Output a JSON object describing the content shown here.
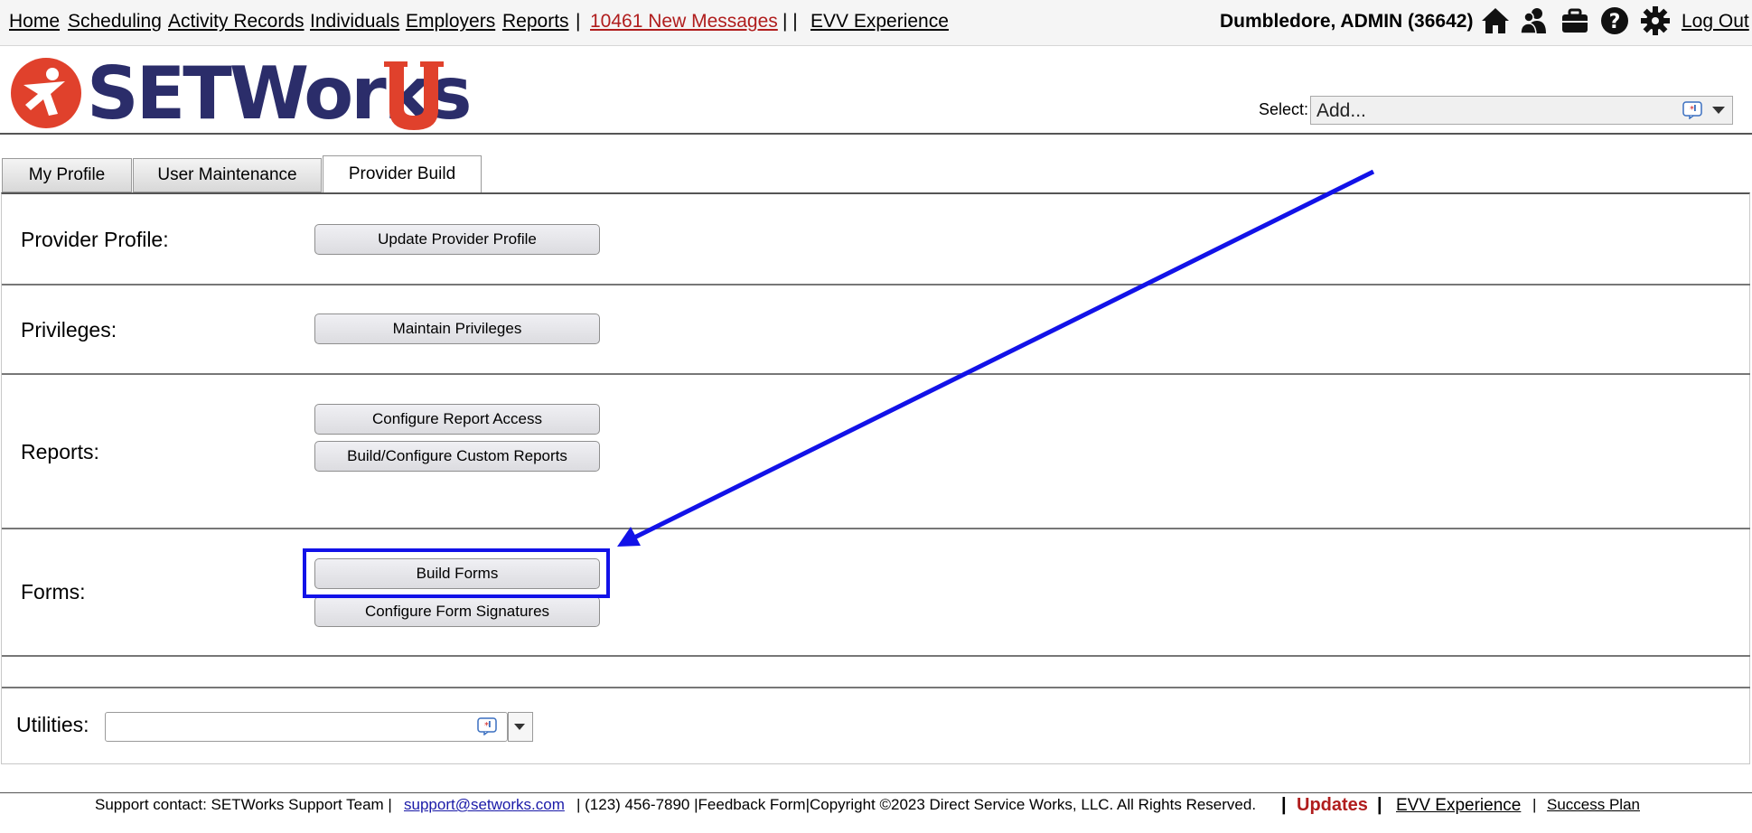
{
  "nav": {
    "links": [
      "Home",
      "Scheduling",
      "Activity Records",
      "Individuals",
      "Employers",
      "Reports"
    ],
    "separator": "|",
    "double_separator": "| |",
    "messages": "10461 New Messages",
    "evv": "EVV Experience",
    "user": "Dumbledore, ADMIN  (36642)",
    "logout": "Log Out",
    "icons": [
      "home-icon",
      "people-icon",
      "briefcase-icon",
      "help-icon",
      "settings-icon"
    ]
  },
  "brand": {
    "name": "SETWorks",
    "colors": {
      "navy": "#2b2d6a",
      "red": "#e0412c",
      "highlight": "#1212e8"
    }
  },
  "select": {
    "label": "Select:",
    "value": "Add..."
  },
  "tabs": [
    "My Profile",
    "User Maintenance",
    "Provider Build"
  ],
  "active_tab": "Provider Build",
  "sections": {
    "provider_profile": {
      "label": "Provider Profile:",
      "buttons": [
        "Update Provider Profile"
      ]
    },
    "privileges": {
      "label": "Privileges:",
      "buttons": [
        "Maintain Privileges"
      ]
    },
    "reports": {
      "label": "Reports:",
      "buttons": [
        "Configure Report Access",
        "Build/Configure Custom Reports"
      ]
    },
    "forms": {
      "label": "Forms:",
      "buttons": [
        "Build Forms",
        "Configure Form Signatures"
      ]
    }
  },
  "utilities": {
    "label": "Utilities:",
    "value": ""
  },
  "footer": {
    "support": "Support contact: SETWorks Support Team |",
    "email": "support@setworks.com",
    "rest": "| (123) 456-7890 |Feedback Form|Copyright ©2023 Direct Service Works, LLC. All Rights Reserved.",
    "bar": "|",
    "updates": "Updates",
    "evv": "EVV Experience",
    "success": "Success Plan"
  }
}
